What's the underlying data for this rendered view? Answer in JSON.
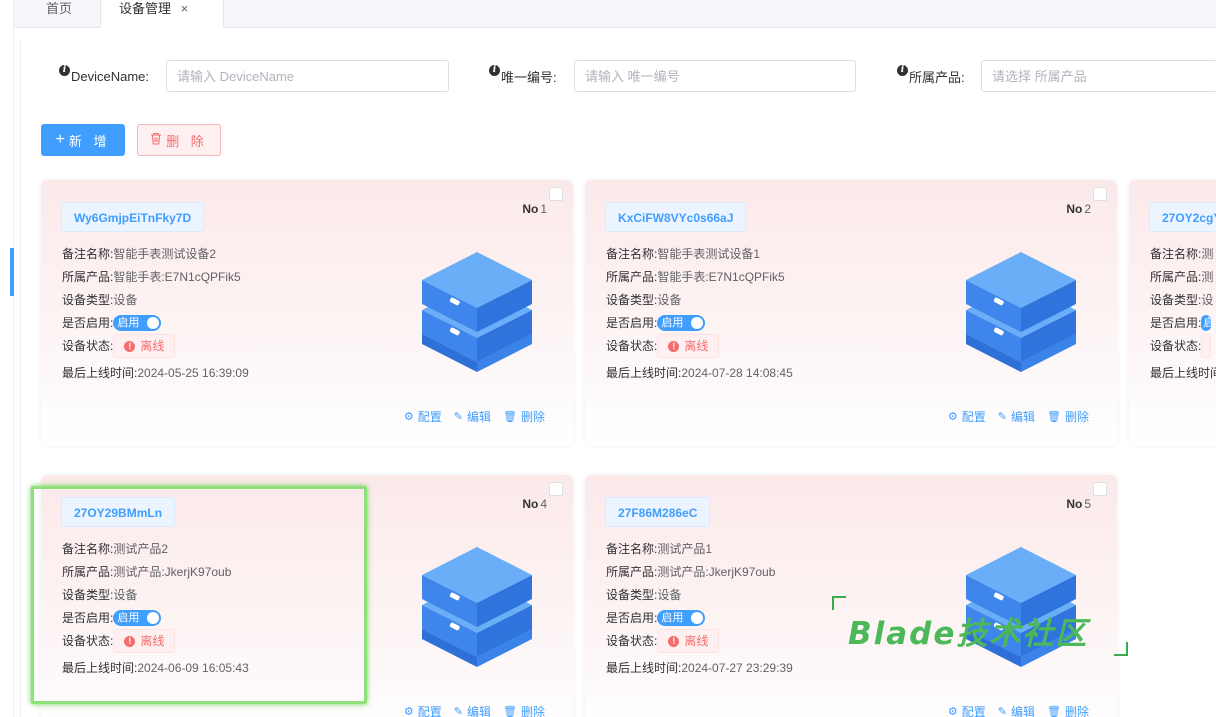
{
  "tabs": {
    "home": "首页",
    "active": "设备管理",
    "close": "×"
  },
  "search": {
    "device_name_label": "DeviceName:",
    "device_name_placeholder": "请输入 DeviceName",
    "unique_id_label": "唯一编号:",
    "unique_id_placeholder": "请输入 唯一编号",
    "product_label": "所属产品:",
    "product_placeholder": "请选择 所属产品"
  },
  "toolbar": {
    "add_icon": "+",
    "add_label": "新 增",
    "delete_icon": "🗑",
    "delete_label": "删 除"
  },
  "labels": {
    "no": "No",
    "remark": "备注名称:",
    "product": "所属产品:",
    "type": "设备类型:",
    "enabled": "是否启用:",
    "status": "设备状态:",
    "last_online": "最后上线时间:",
    "config": "配置",
    "edit": "编辑",
    "delete": "删除"
  },
  "devices": [
    {
      "key": "Wy6GmjpEiTnFky7D",
      "no": "1",
      "remark": "智能手表测试设备2",
      "product": "智能手表:E7N1cQPFik5",
      "type": "设备",
      "enabled": "启用",
      "status": "离线",
      "last_online": "2024-05-25 16:39:09"
    },
    {
      "key": "KxCiFW8VYc0s66aJ",
      "no": "2",
      "remark": "智能手表测试设备1",
      "product": "智能手表:E7N1cQPFik5",
      "type": "设备",
      "enabled": "启用",
      "status": "离线",
      "last_online": "2024-07-28 14:08:45"
    },
    {
      "key": "27OY2cgY",
      "remark": "测",
      "product": "测",
      "type": "设",
      "enabled": "启",
      "last_online": "最后上线时间"
    },
    {
      "key": "27OY29BMmLn",
      "no": "4",
      "remark": "测试产品2",
      "product": "测试产品:JkerjK97oub",
      "type": "设备",
      "enabled": "启用",
      "status": "离线",
      "last_online": "2024-06-09 16:05:43"
    },
    {
      "key": "27F86M286eC",
      "no": "5",
      "remark": "测试产品1",
      "product": "测试产品:JkerjK97oub",
      "type": "设备",
      "enabled": "启用",
      "status": "离线",
      "last_online": "2024-07-27 23:29:39"
    }
  ],
  "watermark": "Blade技术社区",
  "colors": {
    "primary": "#409eff",
    "danger": "#f56c6c",
    "card_bg": "#fbe9ea",
    "highlight": "#8ee07a",
    "watermark": "#4cb85a"
  }
}
